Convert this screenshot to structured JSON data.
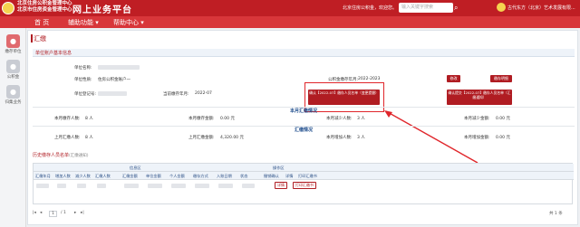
{
  "header": {
    "brand_line1": "北京住房公积金管理中心",
    "brand_line2": "北京市住房资金管理中心",
    "title": "网上业务平台",
    "welcome": "北京住房公积金，欢迎您。",
    "search_placeholder": "输入关键字搜索",
    "company": "古代东方（北京）艺术发展有限..."
  },
  "nav": {
    "home": "首 页",
    "aux": "辅助功能 ▾",
    "help": "帮助中心 ▾"
  },
  "sidebar": {
    "items": [
      {
        "label": "缴存单位",
        "icon": "user-icon"
      },
      {
        "label": "公积金",
        "icon": "person-icon"
      },
      {
        "label": "归集业务",
        "icon": "group-icon"
      }
    ]
  },
  "page": {
    "title": "汇缴",
    "section": "单位账户基本信息"
  },
  "info": {
    "label_unit_name": "单位名称:",
    "label_unit_type": "单位性质:",
    "value_unit_type": "住房公积金账户一",
    "label_pay_period": "公积金缴存年月:",
    "value_pay_period": "2022-2023",
    "label_account_code": "单位登记号:",
    "label_current_month": "当前缴存年月:",
    "value_current_month": "2022-07",
    "btn_modify": "修改",
    "btn_print_detail": "缴存明细",
    "btn_confirm_list": "确认【2022-07】缴存人员名单（变更提醒）",
    "btn_confirm_list2": "确认提交【2022-07】缴存人员名单（汇缴通知）"
  },
  "month_band": {
    "title": "本月汇缴情况",
    "label_count": "本月缴存人数:",
    "value_count": "8 人",
    "label_amount": "本月缴存金额:",
    "value_amount": "0.00 元",
    "label_reduce": "本月减少人数:",
    "value_reduce": "3 人",
    "label_reduce_amount": "本月减少金额:",
    "value_reduce_amount": "0.00 元"
  },
  "summary_band": {
    "title": "汇缴情况",
    "label_prev_count": "上月汇缴人数:",
    "value_prev_count": "8 人",
    "label_prev_amount": "上月汇缴金额:",
    "value_prev_amount": "4,320.00 元",
    "label_add": "本月增加人数:",
    "value_add": "3 人",
    "label_add_amount": "本月增加金额:",
    "value_add_amount": "0.00 元"
  },
  "history": {
    "title": "历史缴存人员名单",
    "subtitle": "(汇缴通知)",
    "group_info": "信息区",
    "group_ops": "操作区",
    "columns": [
      "汇缴年月",
      "增加人数",
      "减少人数",
      "汇缴人数",
      "汇缴金额",
      "单位金额",
      "个人金额",
      "缴存方式",
      "入账日期",
      "状态",
      "撤销确认",
      "详情",
      "打印汇缴书"
    ],
    "btn_detail": "详情",
    "btn_print": "打印汇缴书"
  },
  "pager": {
    "page": "1",
    "total": "/ 1",
    "info": "共 1 条"
  }
}
